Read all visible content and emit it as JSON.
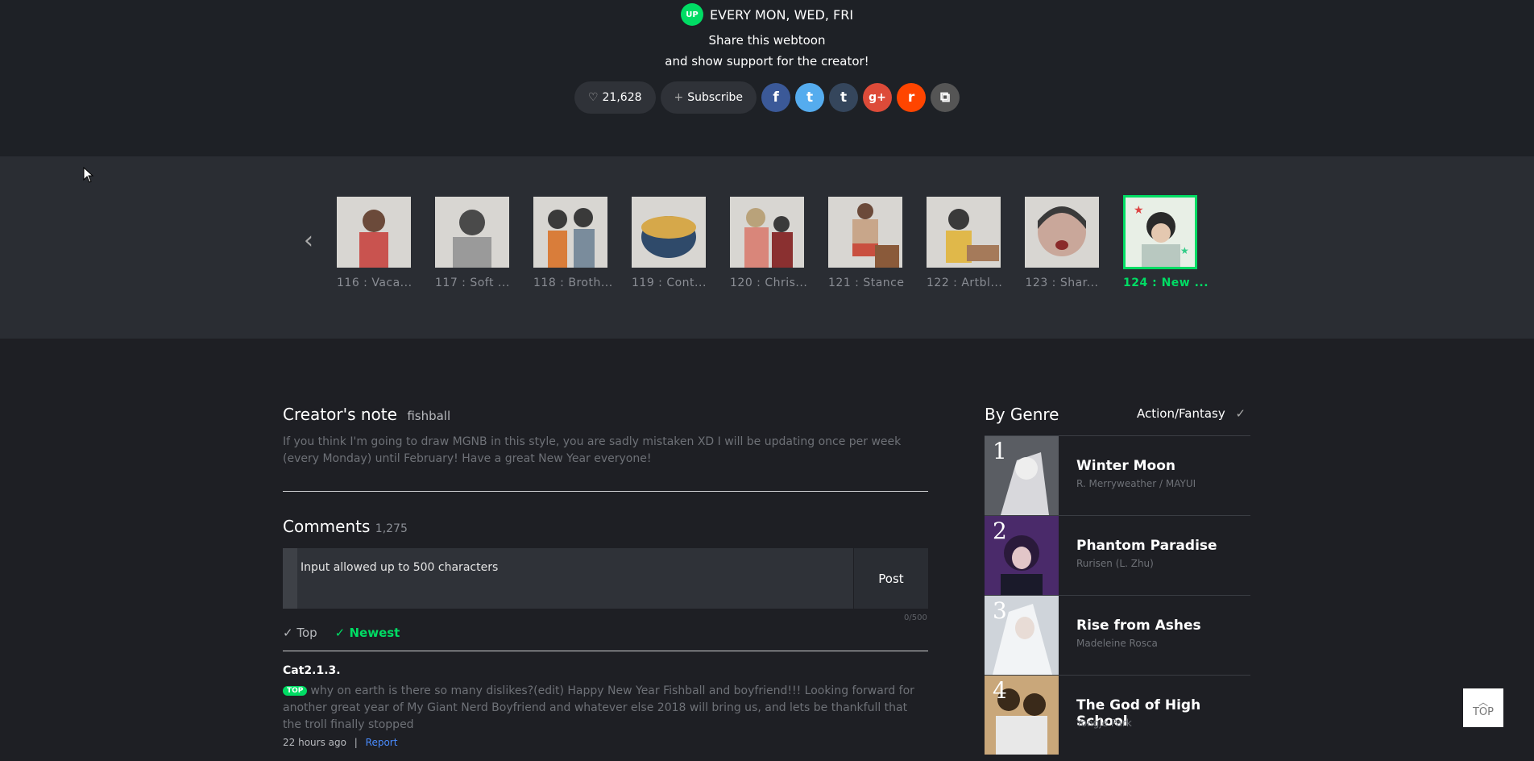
{
  "schedule": {
    "badge": "UP",
    "text": "EVERY MON, WED, FRI"
  },
  "share": {
    "line1": "Share this webtoon",
    "line2": "and show support for the creator!"
  },
  "actions": {
    "likes": "21,628",
    "subscribe": "Subscribe"
  },
  "social": [
    {
      "name": "facebook",
      "glyph": "f",
      "color": "#3b5998"
    },
    {
      "name": "twitter",
      "glyph": "t",
      "color": "#55acee"
    },
    {
      "name": "tumblr",
      "glyph": "t",
      "color": "#35465c"
    },
    {
      "name": "google-plus",
      "glyph": "g+",
      "color": "#dd4b39"
    },
    {
      "name": "reddit",
      "glyph": "r",
      "color": "#ff4500"
    },
    {
      "name": "copy",
      "glyph": "⧉",
      "color": "#555"
    }
  ],
  "episodes": [
    {
      "label": "116 : Vaca..."
    },
    {
      "label": "117 : Soft ..."
    },
    {
      "label": "118 : Broth..."
    },
    {
      "label": "119 : Cont..."
    },
    {
      "label": "120 : Chris..."
    },
    {
      "label": "121 : Stance"
    },
    {
      "label": "122 : Artbl..."
    },
    {
      "label": "123 : Shar..."
    },
    {
      "label": "124 : New ..."
    }
  ],
  "creator_note": {
    "title": "Creator's note",
    "author": "fishball",
    "text": "If you think I'm going to draw MGNB in this style, you are sadly mistaken XD I will be updating once per week (every Monday) until February! Have a great New Year everyone!"
  },
  "comments": {
    "title": "Comments",
    "count": "1,275",
    "placeholder": "Input allowed up to 500 characters",
    "post": "Post",
    "counter": "0/500",
    "sort_top": "Top",
    "sort_newest": "Newest",
    "first": {
      "author": "Cat2.1.3.",
      "badge": "TOP",
      "text": "why on earth is there so many dislikes?(edit) Happy New Year Fishball and boyfriend!!! Looking forward for another great year of My Giant Nerd Boyfriend and whatever else 2018 will bring us, and lets be thankfull that the troll finally stopped",
      "time": "22 hours ago",
      "report": "Report"
    }
  },
  "genre": {
    "title": "By Genre",
    "selected": "Action/Fantasy",
    "items": [
      {
        "rank": "1",
        "title": "Winter Moon",
        "author": "R. Merryweather / MAYUI"
      },
      {
        "rank": "2",
        "title": "Phantom Paradise",
        "author": "Rurisen (L. Zhu)"
      },
      {
        "rank": "3",
        "title": "Rise from Ashes",
        "author": "Madeleine Rosca"
      },
      {
        "rank": "4",
        "title": "The God of High School",
        "author": "Yongje Park"
      }
    ]
  },
  "top_button": "TOP"
}
